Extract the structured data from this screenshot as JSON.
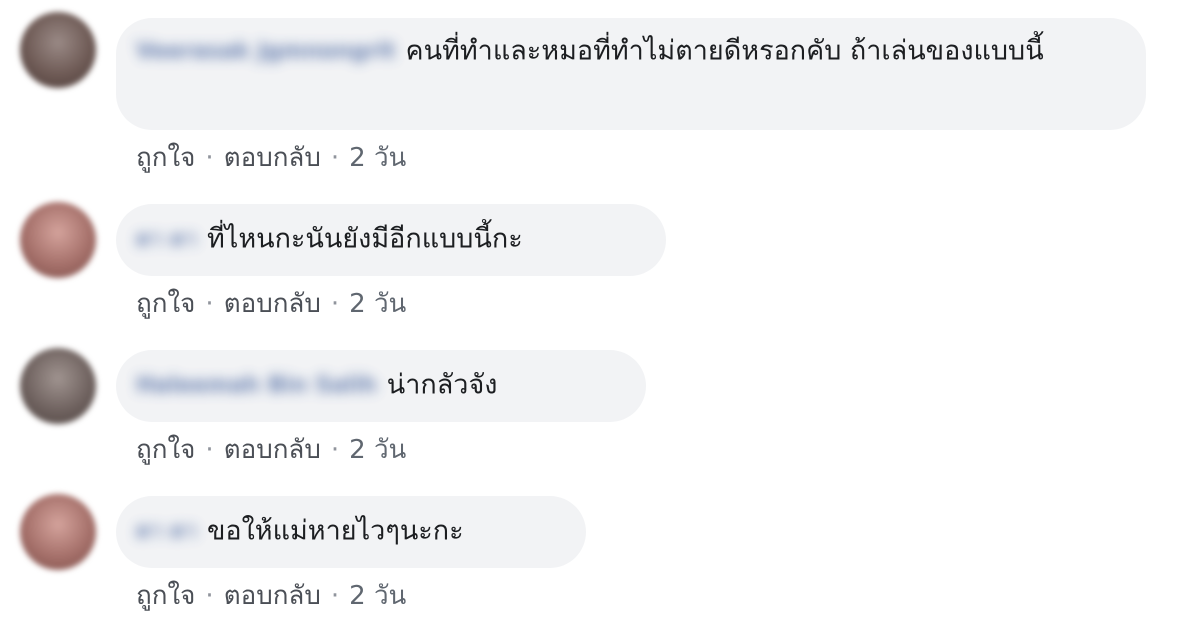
{
  "comments": [
    {
      "author": "Veerasak Jgmnongrit",
      "text": "คนที่ทำและหมอที่ทำไม่ตายดีหรอกคับ ถ้าเล่นของแบบนี้",
      "like": "ถูกใจ",
      "reply": "ตอบกลับ",
      "time": "2 วัน",
      "avatar_color": "#6e5a55"
    },
    {
      "author": "ดา ดา",
      "text": "ที่ไหนกะนันยังมีอีกแบบนี้กะ",
      "like": "ถูกใจ",
      "reply": "ตอบกลับ",
      "time": "2 วัน",
      "avatar_color": "#a5706a"
    },
    {
      "author": "Haleemah Bin Salih",
      "text": "น่ากลัวจัง",
      "like": "ถูกใจ",
      "reply": "ตอบกลับ",
      "time": "2 วัน",
      "avatar_color": "#6f625f"
    },
    {
      "author": "ดา ดา",
      "text": "ขอให้แม่หายไวๆนะกะ",
      "like": "ถูกใจ",
      "reply": "ตอบกลับ",
      "time": "2 วัน",
      "avatar_color": "#a5706a"
    }
  ],
  "separator": "·"
}
